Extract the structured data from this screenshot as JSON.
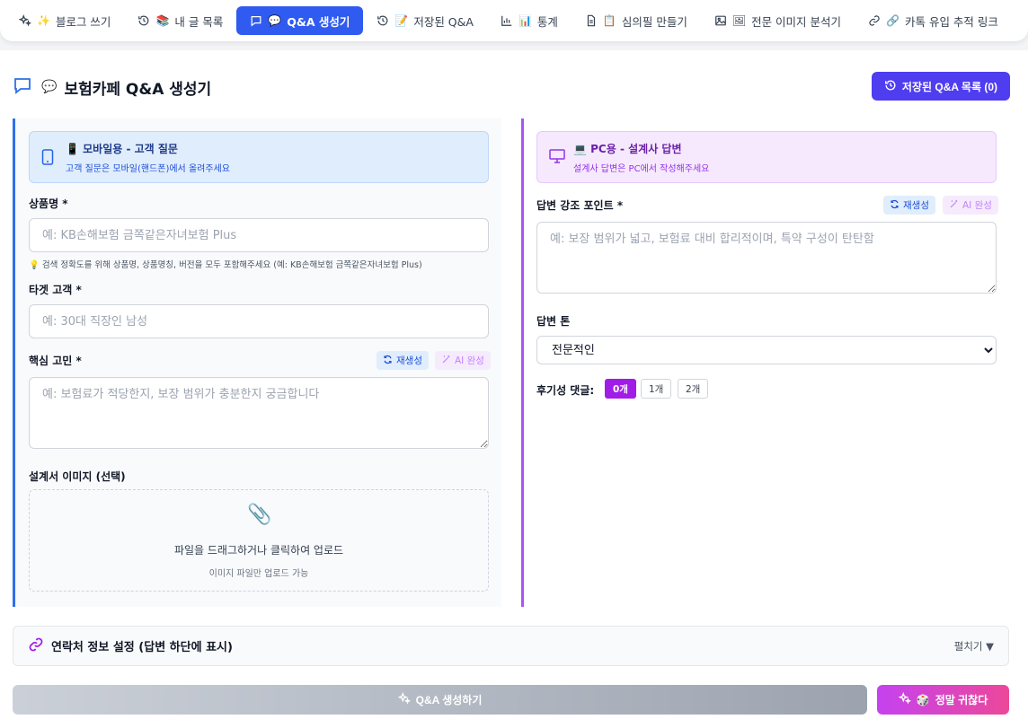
{
  "nav": {
    "tabs": [
      {
        "emoji": "✨",
        "label": "블로그 쓰기",
        "icon": "sparkles-icon"
      },
      {
        "emoji": "📚",
        "label": "내 글 목록",
        "icon": "history-icon"
      },
      {
        "emoji": "💬",
        "label": "Q&A 생성기",
        "icon": "chat-icon",
        "active": true
      },
      {
        "emoji": "📝",
        "label": "저장된 Q&A",
        "icon": "history-icon"
      },
      {
        "emoji": "📊",
        "label": "통계",
        "icon": "bar-chart-icon"
      },
      {
        "emoji": "📋",
        "label": "심의필 만들기",
        "icon": "document-icon"
      },
      {
        "emoji": "🖼",
        "label": "전문 이미지 분석기",
        "icon": "image-icon"
      },
      {
        "emoji": "🔗",
        "label": "카톡 유입 추적 링크",
        "icon": "link-icon"
      }
    ]
  },
  "header": {
    "emoji": "💬",
    "title": "보험카페 Q&A 생성기",
    "saved_button": "저장된 Q&A 목록 (0)"
  },
  "left": {
    "info_emoji": "📱",
    "info_title": "모바일용 - 고객 질문",
    "info_sub": "고객 질문은 모바일(핸드폰)에서 올려주세요",
    "product_label": "상품명 *",
    "product_placeholder": "예: KB손해보험 금쪽같은자녀보험 Plus",
    "product_hint": "💡 검색 정확도를 위해 상품명, 상품명칭, 버전을 모두 포함해주세요 (예: KB손해보험 금쪽같은자녀보험 Plus)",
    "target_label": "타겟 고객 *",
    "target_placeholder": "예: 30대 직장인 남성",
    "concern_label": "핵심 고민 *",
    "concern_placeholder": "예: 보험료가 적당한지, 보장 범위가 충분한지 궁금합니다",
    "regen_label": "재생성",
    "ai_label": "AI 완성",
    "image_label": "설계서 이미지 (선택)",
    "upload_emoji": "📎",
    "upload_main": "파일을 드래그하거나 클릭하여 업로드",
    "upload_sub": "이미지 파일만 업로드 가능"
  },
  "right": {
    "info_emoji": "💻",
    "info_title": "PC용 - 설계사 답변",
    "info_sub": "설계사 답변은 PC에서 작성해주세요",
    "point_label": "답변 강조 포인트 *",
    "point_placeholder": "예: 보장 범위가 넓고, 보험료 대비 합리적이며, 특약 구성이 탄탄함",
    "regen_label": "재생성",
    "ai_label": "AI 완성",
    "tone_label": "답변 톤",
    "tone_value": "전문적인",
    "review_label": "후기성 댓글:",
    "review_options": [
      "0개",
      "1개",
      "2개"
    ]
  },
  "contact": {
    "title": "연락처 정보 설정 (답변 하단에 표시)",
    "toggle": "펼치기 ▼"
  },
  "actions": {
    "generate": "Q&A 생성하기",
    "fun_emoji": "🎲",
    "fun": "정말 귀찮다"
  },
  "colors": {
    "primary": "#2f5bf0",
    "saved_button": "#4f3df0",
    "left_accent": "#2f6fe8",
    "right_accent": "#a855f7",
    "count_active": "#a21ce8",
    "fun_gradient": [
      "#c542f0",
      "#ec4899"
    ]
  }
}
